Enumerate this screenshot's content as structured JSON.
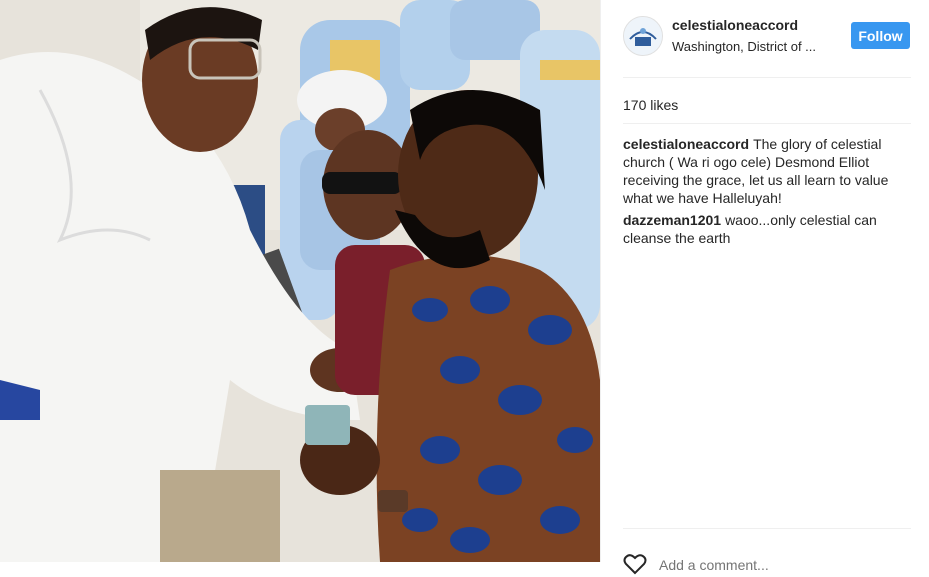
{
  "post": {
    "username": "celestialoneaccord",
    "location": "Washington, District of ...",
    "follow_label": "Follow",
    "likes": "170 likes",
    "comments": [
      {
        "author": "celestialoneaccord",
        "text": "The glory of celestial church ( Wa ri ogo cele) Desmond Elliot receiving the grace, let us all learn to value what we have Halleluyah!"
      },
      {
        "author": "dazzeman1201",
        "text": "waoo...only celestial can cleanse the earth"
      }
    ],
    "add_comment_placeholder": "Add a comment..."
  },
  "colors": {
    "accent": "#3897f0",
    "text": "#262626",
    "divider": "#efefef"
  },
  "icons": {
    "heart": "heart-icon",
    "avatar": "celestial-church-logo"
  }
}
